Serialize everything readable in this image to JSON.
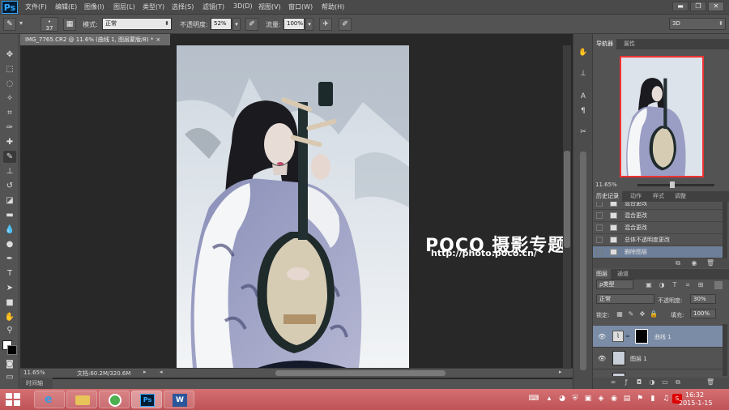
{
  "app": {
    "logo": "Ps"
  },
  "menu": [
    "文件(F)",
    "编辑(E)",
    "图像(I)",
    "图层(L)",
    "类型(Y)",
    "选择(S)",
    "滤镜(T)",
    "3D(D)",
    "视图(V)",
    "窗口(W)",
    "帮助(H)"
  ],
  "window_controls": {
    "minimize": "▬",
    "restore": "❐",
    "close": "✕"
  },
  "options": {
    "brush_size": "37",
    "mode_label": "模式:",
    "mode_value": "正常",
    "opacity_label": "不透明度:",
    "opacity_value": "52%",
    "flow_label": "流量:",
    "flow_value": "100%",
    "workspace": "3D"
  },
  "document": {
    "tab_title": "IMG_7765.CR2 @ 11.6% (曲线 1, 图层蒙版/8) *",
    "close": "×"
  },
  "status": {
    "zoom": "11.65%",
    "doc_size": "文档:60.2M/320.6M"
  },
  "timeline_tab": "时间轴",
  "watermark": {
    "brand": "POCO 摄影专题",
    "url": "http://photo.poco.cn/"
  },
  "navigator": {
    "tabs": [
      "导航器",
      "属性"
    ],
    "zoom": "11.65%"
  },
  "history": {
    "tabs": [
      "历史记录",
      "动作",
      "样式",
      "调整"
    ],
    "items": [
      {
        "label": "混合更改",
        "selected": false
      },
      {
        "label": "混合更改",
        "selected": false
      },
      {
        "label": "混合更改",
        "selected": false
      },
      {
        "label": "总体不透明度更改",
        "selected": false
      },
      {
        "label": "删除图层",
        "selected": true
      }
    ]
  },
  "layers": {
    "tabs": [
      "图层",
      "通道"
    ],
    "filter_label": "ρ类型",
    "blend_mode": "正常",
    "opacity_label": "不透明度:",
    "opacity_value": "30%",
    "lock_label": "锁定:",
    "fill_label": "填充:",
    "fill_value": "100%",
    "items": [
      {
        "name": "曲线 1",
        "selected": true
      },
      {
        "name": "图层 1",
        "selected": false
      },
      {
        "name": "图层",
        "selected": false
      }
    ]
  },
  "taskbar": {
    "time": "16:32",
    "date": "2015-1-15"
  },
  "colors": {
    "accent": "#31a8ff",
    "selection": "#7a8ca6",
    "taskbar": "#c75a5d",
    "nav_frame": "#e33333"
  }
}
